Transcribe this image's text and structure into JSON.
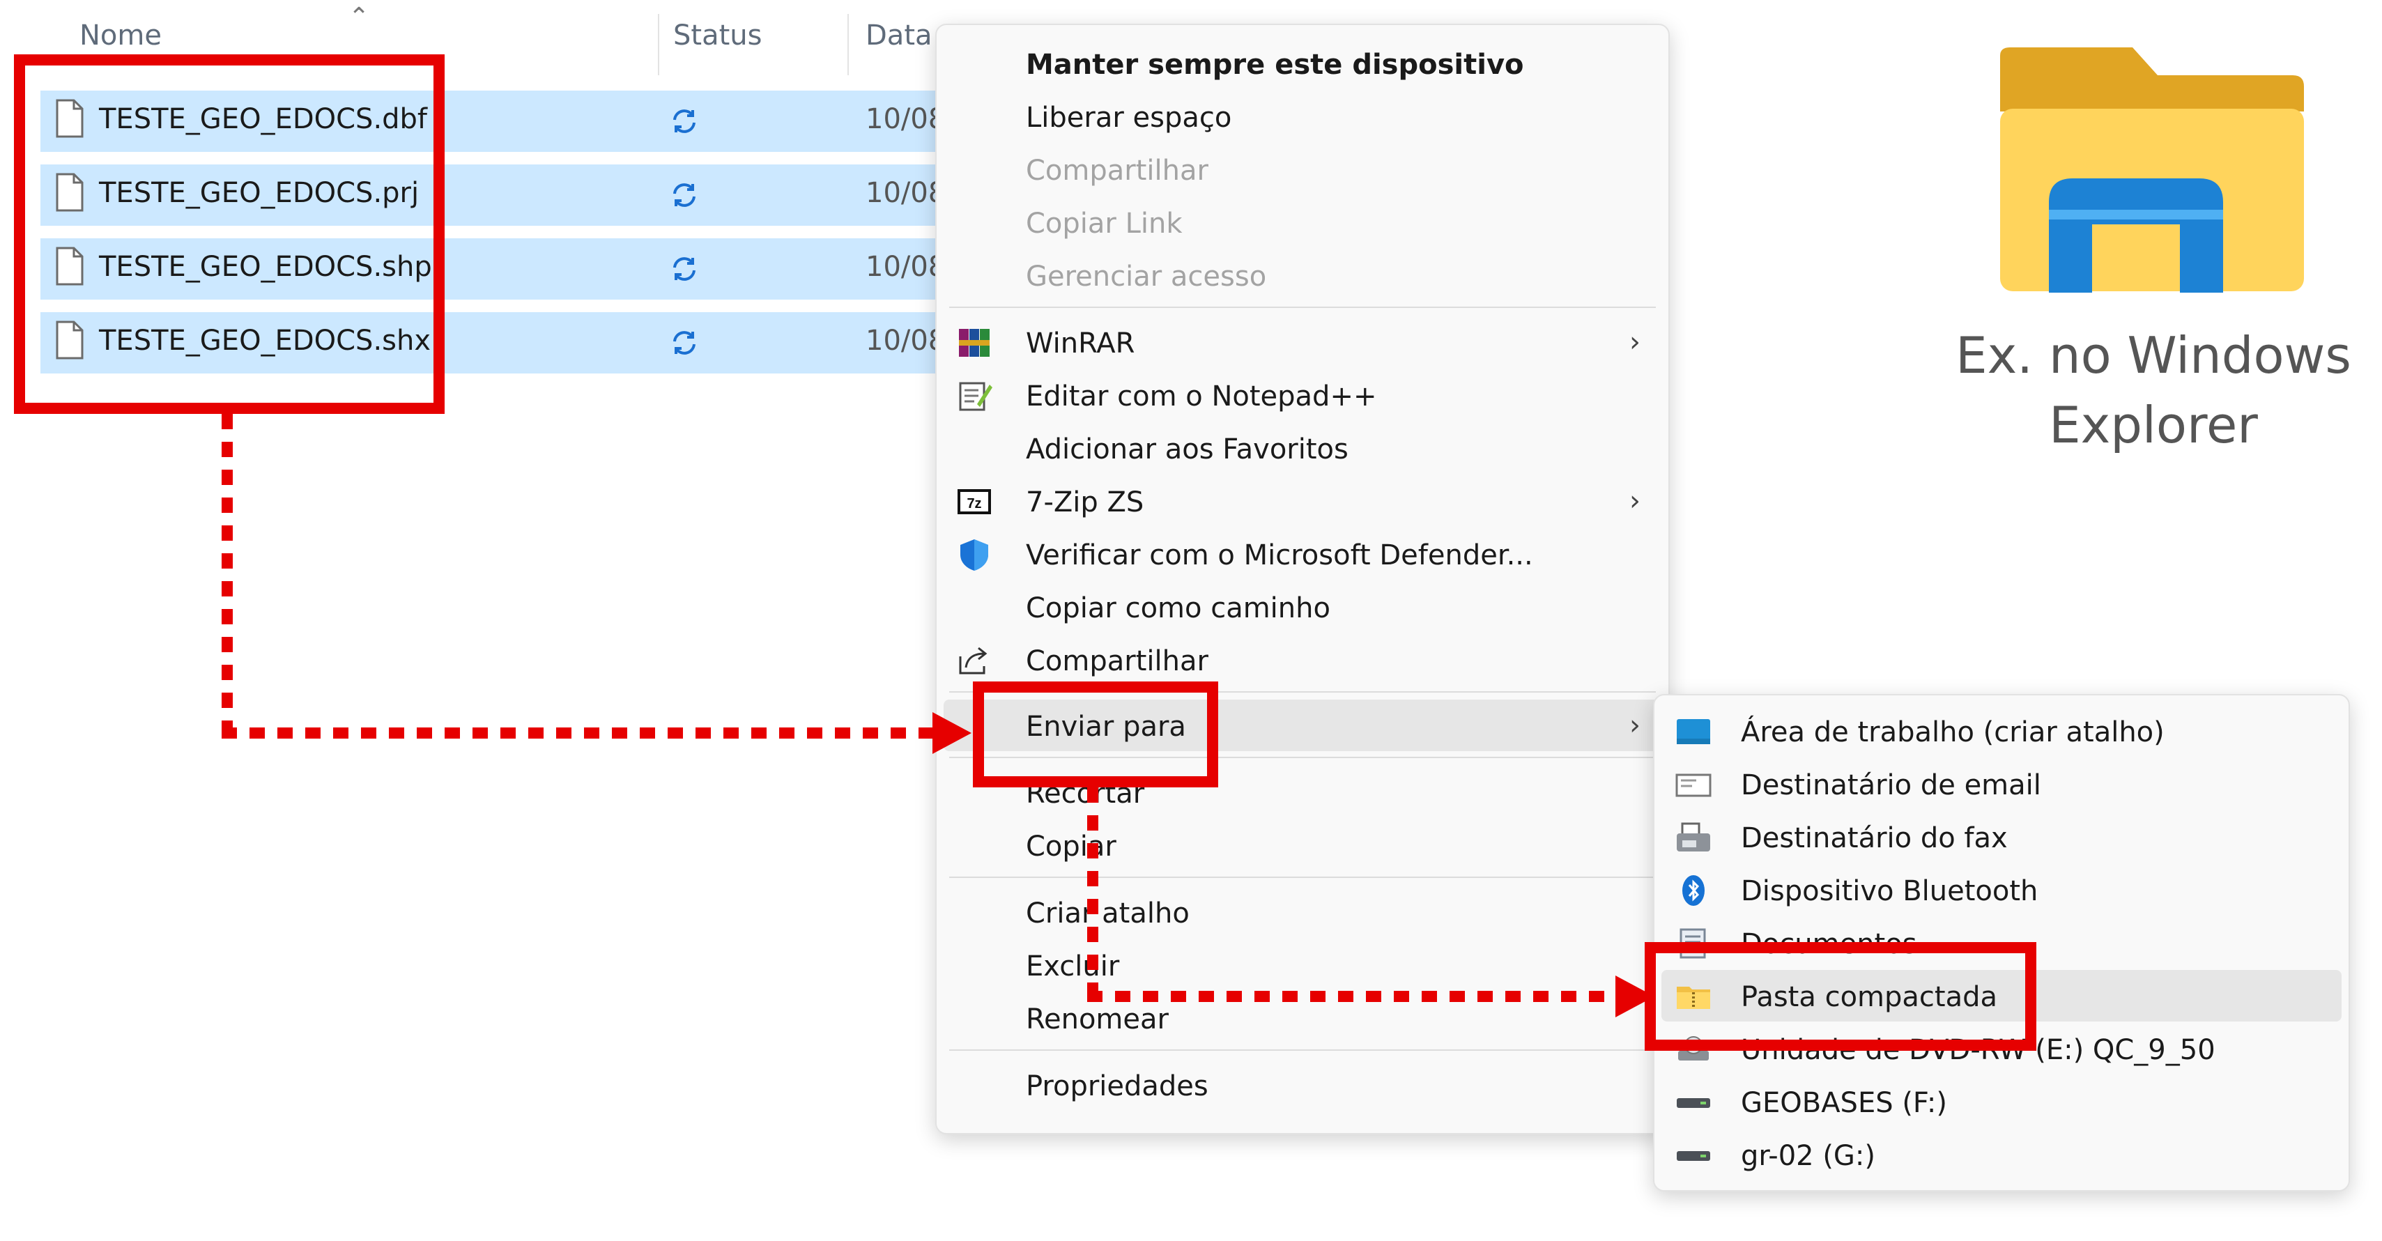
{
  "columns": {
    "name": "Nome",
    "status": "Status",
    "date": "Data"
  },
  "files": [
    {
      "name": "TESTE_GEO_EDOCS.dbf",
      "date": "10/08"
    },
    {
      "name": "TESTE_GEO_EDOCS.prj",
      "date": "10/08"
    },
    {
      "name": "TESTE_GEO_EDOCS.shp",
      "date": "10/08"
    },
    {
      "name": "TESTE_GEO_EDOCS.shx",
      "date": "10/08"
    }
  ],
  "context_menu": {
    "items": [
      {
        "label": "Manter sempre este dispositivo",
        "style": "bold"
      },
      {
        "label": "Liberar espaço"
      },
      {
        "label": "Compartilhar",
        "disabled": true
      },
      {
        "label": "Copiar Link",
        "disabled": true
      },
      {
        "label": "Gerenciar acesso",
        "disabled": true
      },
      {
        "label": "WinRAR",
        "icon": "winrar-icon",
        "submenu": true
      },
      {
        "label": "Editar com o Notepad++",
        "icon": "notepad-icon"
      },
      {
        "label": "Adicionar aos Favoritos"
      },
      {
        "label": "7-Zip ZS",
        "icon": "7zip-icon",
        "submenu": true
      },
      {
        "label": "Verificar com o Microsoft Defender...",
        "icon": "defender-shield-icon"
      },
      {
        "label": "Copiar como caminho"
      },
      {
        "label": "Compartilhar",
        "icon": "share-icon"
      },
      {
        "label": "Enviar para",
        "submenu": true,
        "highlighted": true
      },
      {
        "label": "Recortar"
      },
      {
        "label": "Copiar"
      },
      {
        "label": "Criar atalho"
      },
      {
        "label": "Excluir"
      },
      {
        "label": "Renomear"
      },
      {
        "label": "Propriedades"
      }
    ]
  },
  "send_to_menu": {
    "items": [
      {
        "label": "Área de trabalho (criar atalho)",
        "icon": "desktop-icon"
      },
      {
        "label": "Destinatário de email",
        "icon": "mail-icon"
      },
      {
        "label": "Destinatário do fax",
        "icon": "fax-icon"
      },
      {
        "label": "Dispositivo Bluetooth",
        "icon": "bluetooth-icon"
      },
      {
        "label": "Documentos",
        "icon": "documents-icon"
      },
      {
        "label": "Pasta compactada",
        "icon": "zip-folder-icon",
        "highlighted": true
      },
      {
        "label": "Unidade de DVD-RW (E:) QC_9_50",
        "icon": "dvd-drive-icon"
      },
      {
        "label": "GEOBASES (F:)",
        "icon": "drive-icon"
      },
      {
        "label": "gr-02 (G:)",
        "icon": "drive-icon"
      }
    ]
  },
  "caption": {
    "line1": "Ex. no Windows",
    "line2": "Explorer"
  },
  "colors": {
    "annotation": "#e60000",
    "selection": "#cce8ff",
    "menu_bg": "#f9f9f9",
    "highlight": "#e6e6e6"
  }
}
